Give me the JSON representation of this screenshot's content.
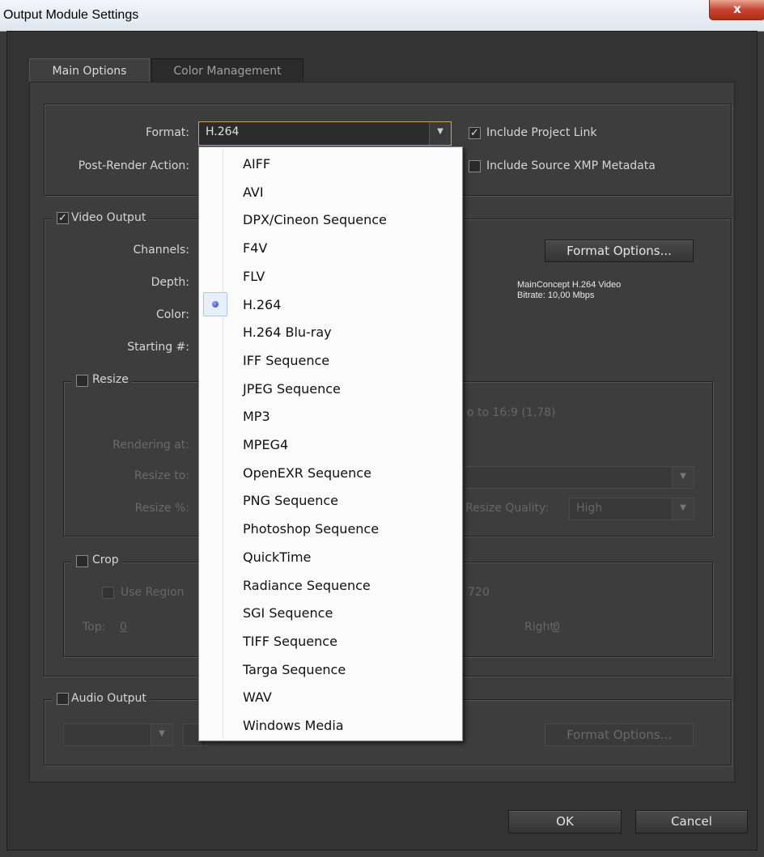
{
  "window": {
    "title": "Output Module Settings",
    "close_glyph": "x"
  },
  "tabs": [
    {
      "label": "Main Options",
      "active": true
    },
    {
      "label": "Color Management",
      "active": false
    }
  ],
  "top": {
    "format_label": "Format:",
    "format_value": "H.264",
    "post_render_label": "Post-Render Action:",
    "include_project_link": "Include Project Link",
    "include_project_link_checked": true,
    "include_xmp": "Include Source XMP Metadata",
    "include_xmp_checked": false
  },
  "video": {
    "group_label": "Video Output",
    "checked": true,
    "channels_label": "Channels:",
    "depth_label": "Depth:",
    "color_label": "Color:",
    "starting_label": "Starting #:",
    "format_options_button": "Format Options...",
    "info_line1": "MainConcept H.264 Video",
    "info_line2": "Bitrate: 10,00 Mbps"
  },
  "resize": {
    "group_label": "Resize",
    "checked": false,
    "aspect_text": "o to 16:9 (1,78)",
    "rendering_at_label": "Rendering at:",
    "resize_to_label": "Resize to:",
    "resize_pct_label": "Resize %:",
    "resize_quality_label": "Resize Quality:",
    "resize_quality_value": "High"
  },
  "crop": {
    "group_label": "Crop",
    "checked": false,
    "use_region_label": "Use Region",
    "size_text": "720",
    "top_label": "Top:",
    "top_value": "0",
    "right_label": "Right:",
    "right_value": "0"
  },
  "audio": {
    "group_label": "Audio Output",
    "checked": false,
    "format_options_button": "Format Options..."
  },
  "buttons": {
    "ok": "OK",
    "cancel": "Cancel"
  },
  "format_menu": {
    "selected": "H.264",
    "items": [
      "AIFF",
      "AVI",
      "DPX/Cineon Sequence",
      "F4V",
      "FLV",
      "H.264",
      "H.264 Blu-ray",
      "IFF Sequence",
      "JPEG Sequence",
      "MP3",
      "MPEG4",
      "OpenEXR Sequence",
      "PNG Sequence",
      "Photoshop Sequence",
      "QuickTime",
      "Radiance Sequence",
      "SGI Sequence",
      "TIFF Sequence",
      "Targa Sequence",
      "WAV",
      "Windows Media"
    ]
  },
  "icons": {
    "check": "check-icon",
    "dropdown_arrow": "triangle-down-icon",
    "selected_bullet": "radio-bullet-icon"
  },
  "colors": {
    "dialog_bg": "#3d3d3d",
    "menu_bg": "#fbfbfb",
    "accent_border": "#c5a55a"
  }
}
